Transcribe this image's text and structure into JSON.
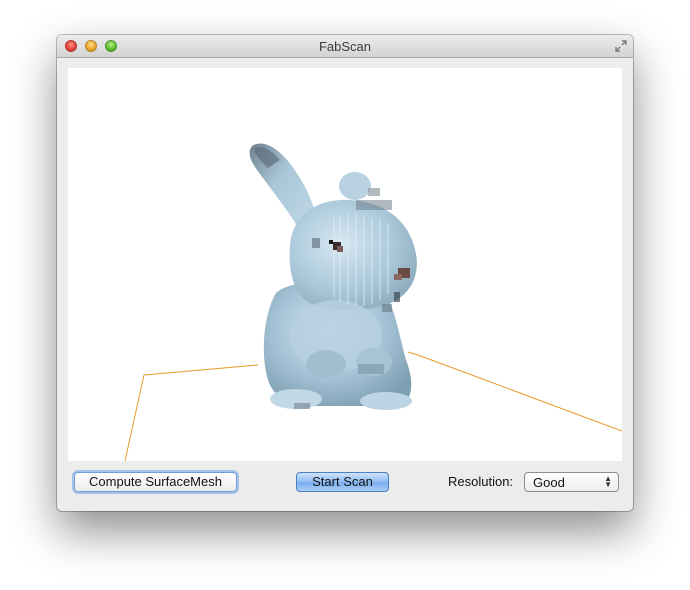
{
  "window": {
    "title": "FabScan"
  },
  "viewport": {
    "guide_color": "#e89a2a"
  },
  "toolbar": {
    "compute_label": "Compute SurfaceMesh",
    "start_label": "Start Scan",
    "resolution_label": "Resolution:",
    "resolution_value": "Good"
  },
  "icons": {
    "close": "close-icon",
    "minimize": "minimize-icon",
    "zoom": "zoom-icon",
    "fullscreen": "fullscreen-icon",
    "select_arrows": "updown-arrows-icon"
  }
}
